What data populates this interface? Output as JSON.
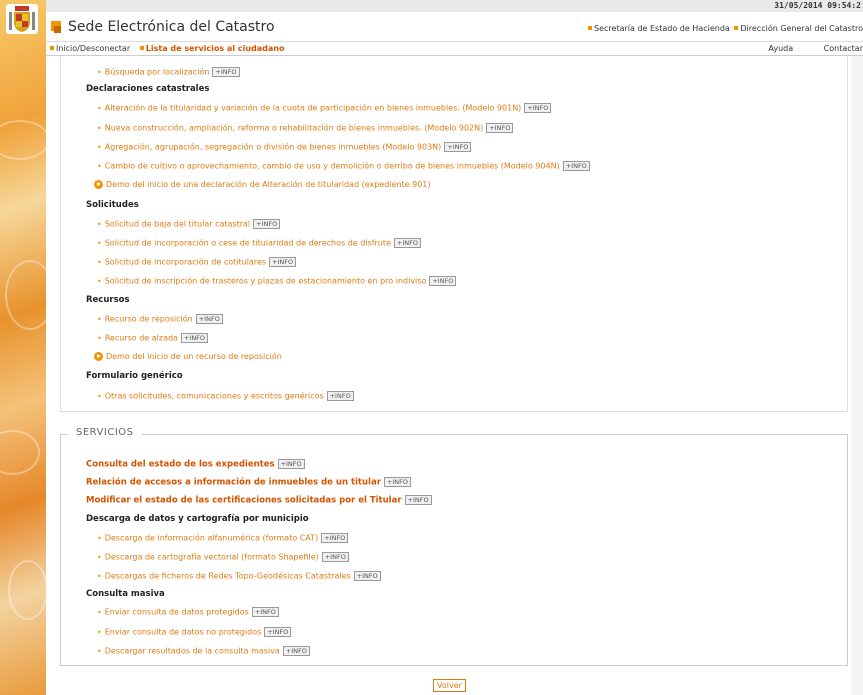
{
  "topbar": {
    "datetime": "31/05/2014 09:54:2"
  },
  "header": {
    "title": "Sede Electrónica del Catastro",
    "link_hacienda": "Secretaría de Estado de Hacienda",
    "link_catastro": "Dirección General del Catastro"
  },
  "nav": {
    "home": "Inicio/Desconectar",
    "services_list": "Lista de servicios al ciudadano",
    "help": "Ayuda",
    "contact": "Contactar"
  },
  "info_label": "+INFO",
  "top_items": {
    "busqueda": "Búsqueda por localización",
    "declaraciones_heading": "Declaraciones catastrales",
    "decl_1": "Alteración de la titularidad y variación de la cuota de participación en bienes inmuebles. (Modelo 901N)",
    "decl_2": "Nueva construcción, ampliación, reforma o rehabilitación de bienes inmuebles. (Modelo 902N)",
    "decl_3": "Agregación, agrupación, segregación o división de bienes inmuebles (Modelo 903N)",
    "decl_4": "Cambio de cultivo o aprovechamiento, cambio de uso y demolición o derribo de bienes inmuebles (Modelo 904N)",
    "decl_demo": "Demo del inicio de una declaración de Alteración de titularidad (expediente 901)",
    "solicitudes_heading": "Solicitudes",
    "sol_1": "Solicitud de baja del titular catastral",
    "sol_2": "Solicitud de incorporación o cese de titularidad de derechos de disfrute",
    "sol_3": "Solicitud de incorporación de cotitulares",
    "sol_4": "Solicitud de inscripción de trasteros y plazas de estacionamiento en pro indiviso",
    "recursos_heading": "Recursos",
    "rec_1": "Recurso de reposición",
    "rec_2": "Recurso de alzada",
    "rec_demo": "Demo del inicio de un recurso de reposición",
    "formulario_heading": "Formulario genérico",
    "form_1": "Otras solicitudes, comunicaciones y escritos genéricos"
  },
  "servicios": {
    "legend": "SERVICIOS",
    "consulta_estado": "Consulta del estado de los expedientes",
    "relacion_accesos": "Relación de accesos a información de inmuebles de un titular",
    "modificar_estado": "Modificar el estado de las certificaciones solicitadas por el Titular",
    "descarga_heading": "Descarga de datos y cartografía por municipio",
    "desc_1": "Descarga de información alfanumérica (formato CAT)",
    "desc_2": "Descarga de cartografía vectorial (formato Shapefile)",
    "desc_3": "Descargas de ficheros de Redes Topo-Geodésicas Catastrales",
    "masiva_heading": "Consulta masiva",
    "mas_1": "Enviar consulta de datos protegidos",
    "mas_2": "Enviar consulta de datos no protegidos",
    "mas_3": "Descargar resultados de la consulta masiva"
  },
  "volver": "Volver"
}
